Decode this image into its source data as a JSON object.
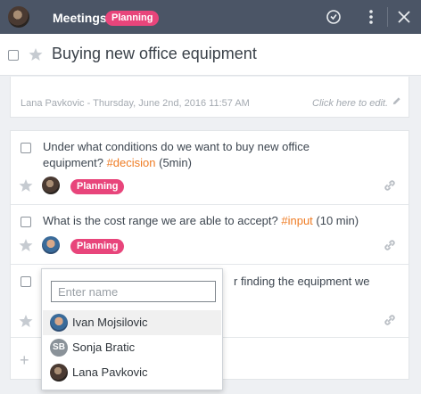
{
  "header": {
    "title": "Meetings",
    "status_badge": "Planning",
    "avatar_icon": "user-avatar",
    "icons": [
      "clock-icon",
      "more-vertical-icon",
      "close-icon"
    ]
  },
  "meeting": {
    "title": "Buying new office equipment"
  },
  "description": {
    "meta": "Lana Pavkovic - Thursday, June 2nd, 2016 11:57 AM",
    "edit_hint": "Click here to edit."
  },
  "agenda": {
    "items": [
      {
        "question_text": "Under what conditions do we want to buy new office equipment? ",
        "tag": "#decision",
        "duration": " (5min)",
        "badge": "Planning",
        "assignee_icon": "lana-avatar"
      },
      {
        "question_text": "What is the cost range we are able to accept? ",
        "tag": "#input",
        "duration": " (10 min)",
        "badge": "Planning",
        "assignee_icon": "ivan-avatar"
      },
      {
        "question_text": "r finding the equipment we",
        "assignee_icon": ""
      }
    ]
  },
  "assignee_dropdown": {
    "placeholder": "Enter name",
    "value": "",
    "options": [
      {
        "name": "Ivan Mojsilovic",
        "initials": "",
        "highlighted": true
      },
      {
        "name": "Sonja Bratic",
        "initials": "SB",
        "highlighted": false
      },
      {
        "name": "Lana Pavkovic",
        "initials": "",
        "highlighted": false
      }
    ]
  },
  "colors": {
    "header_bg": "#4b5566",
    "badge": "#e8457b",
    "tag": "#ef7c24"
  }
}
